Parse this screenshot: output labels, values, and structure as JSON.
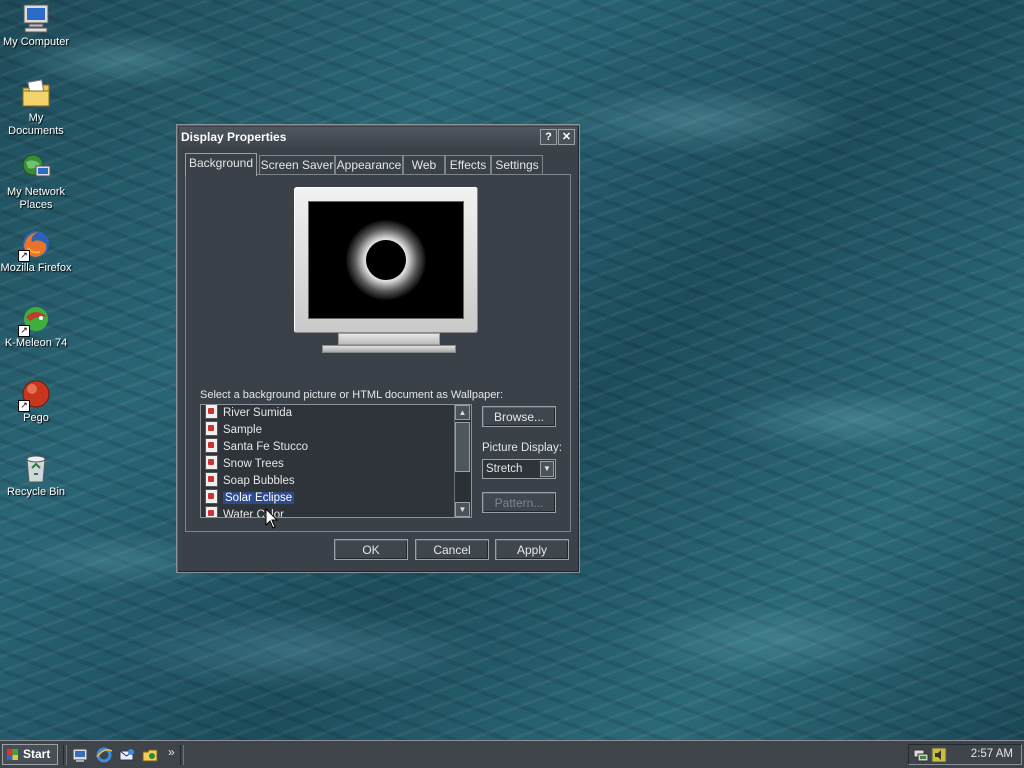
{
  "desktop": {
    "icons": [
      {
        "label": "My Computer",
        "icon": "my-computer-icon"
      },
      {
        "label": "My Documents",
        "icon": "my-documents-icon"
      },
      {
        "label": "My Network Places",
        "icon": "network-places-icon"
      },
      {
        "label": "Mozilla Firefox",
        "icon": "firefox-icon"
      },
      {
        "label": "K-Meleon 74",
        "icon": "kmeleon-icon"
      },
      {
        "label": "Pego",
        "icon": "pego-icon"
      },
      {
        "label": "Recycle Bin",
        "icon": "recycle-bin-icon"
      }
    ]
  },
  "dialog": {
    "title": "Display Properties",
    "help_btn": "?",
    "close_btn": "✕",
    "tabs": [
      "Background",
      "Screen Saver",
      "Appearance",
      "Web",
      "Effects",
      "Settings"
    ],
    "active_tab": "Background",
    "wallpaper_label": "Select a background picture or HTML document as Wallpaper:",
    "wallpapers": [
      "River Sumida",
      "Sample",
      "Santa Fe Stucco",
      "Snow Trees",
      "Soap Bubbles",
      "Solar Eclipse",
      "Water Color"
    ],
    "selected_wallpaper": "Solar Eclipse",
    "browse_label": "Browse...",
    "picture_display_label": "Picture Display:",
    "picture_display_value": "Stretch",
    "pattern_label": "Pattern...",
    "ok_label": "OK",
    "cancel_label": "Cancel",
    "apply_label": "Apply"
  },
  "taskbar": {
    "start_label": "Start",
    "chevron": "»",
    "quick_launch": [
      "show-desktop-icon",
      "ie-icon",
      "outlook-express-icon",
      "explorer-icon"
    ],
    "clock": "2:57 AM"
  },
  "colors": {
    "dialog_bg": "#3a4148",
    "selection": "#2d4b8a",
    "taskbar_bg": "#3e4449"
  }
}
